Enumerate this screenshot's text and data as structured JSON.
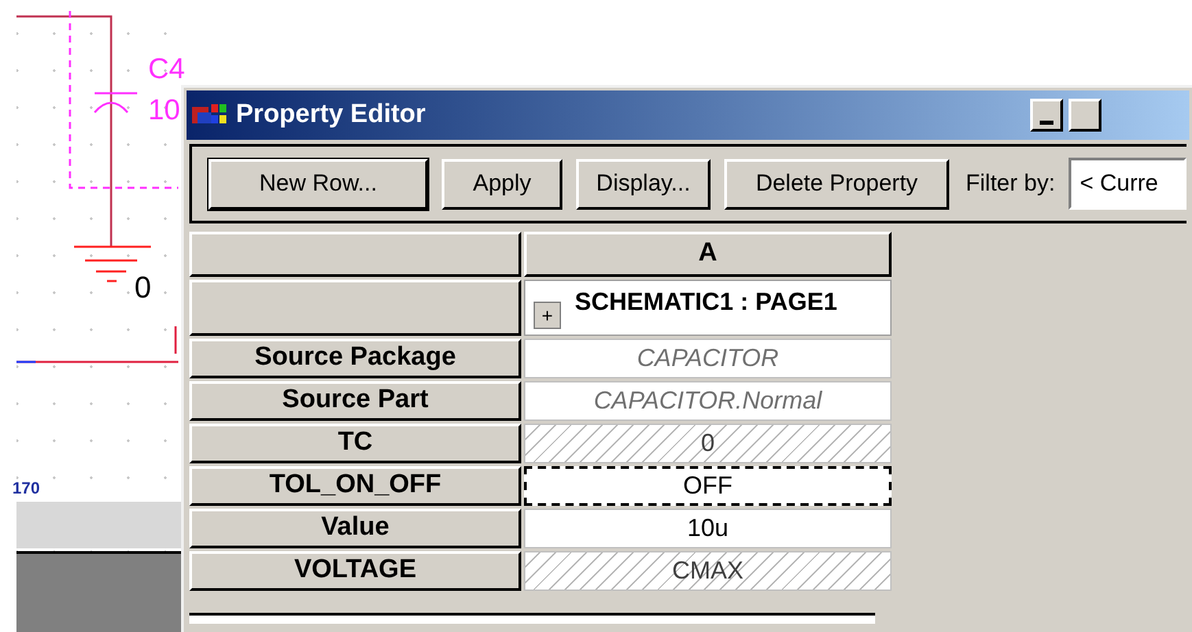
{
  "schematic": {
    "labels": [
      {
        "kind": "ref",
        "text": "C4"
      },
      {
        "kind": "value",
        "text": "10"
      },
      {
        "kind": "ground",
        "text": "0"
      },
      {
        "kind": "net",
        "text": "170"
      }
    ]
  },
  "window": {
    "title": "Property Editor"
  },
  "toolbar": {
    "buttons": [
      "New Row...",
      "Apply",
      "Display...",
      "Delete Property"
    ],
    "filter_label": "Filter by:",
    "filter_value": "< Curre"
  },
  "table": {
    "columns": [
      "A"
    ],
    "group": {
      "expand": "+",
      "label": "SCHEMATIC1 : PAGE1"
    },
    "rows": [
      {
        "name": "Source Package",
        "value": "CAPACITOR",
        "kind": "inherited",
        "selected": false
      },
      {
        "name": "Source Part",
        "value": "CAPACITOR.Normal",
        "kind": "inherited",
        "selected": false
      },
      {
        "name": "TC",
        "value": "0",
        "kind": "hatched",
        "selected": false
      },
      {
        "name": "TOL_ON_OFF",
        "value": "OFF",
        "kind": "plain",
        "selected": true
      },
      {
        "name": "Value",
        "value": "10u",
        "kind": "plain",
        "selected": false
      },
      {
        "name": "VOLTAGE",
        "value": "CMAX",
        "kind": "hatched",
        "selected": false
      }
    ]
  }
}
